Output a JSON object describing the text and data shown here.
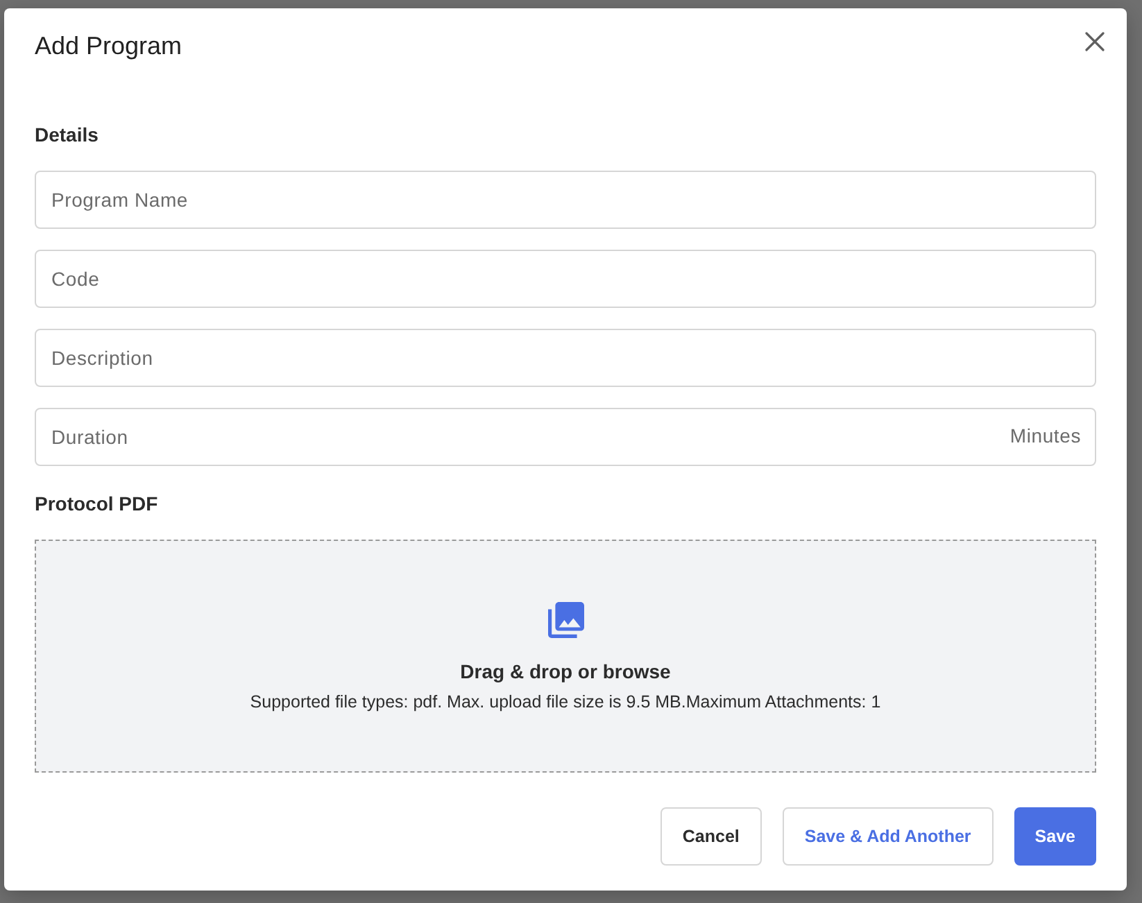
{
  "dialog": {
    "title": "Add Program"
  },
  "details": {
    "heading": "Details",
    "fields": [
      {
        "placeholder": "Program Name"
      },
      {
        "placeholder": "Code"
      },
      {
        "placeholder": "Description"
      },
      {
        "placeholder": "Duration",
        "suffix": "Minutes"
      }
    ]
  },
  "protocol_pdf": {
    "heading": "Protocol PDF",
    "dropzone": {
      "prompt": "Drag & drop or browse",
      "hint": "Supported file types: pdf. Max. upload file size is 9.5 MB.Maximum Attachments: 1"
    }
  },
  "buttons": [
    {
      "label": "Cancel",
      "kind": "default"
    },
    {
      "label": "Save & Add Another",
      "kind": "outline"
    },
    {
      "label": "Save",
      "kind": "primary"
    }
  ]
}
